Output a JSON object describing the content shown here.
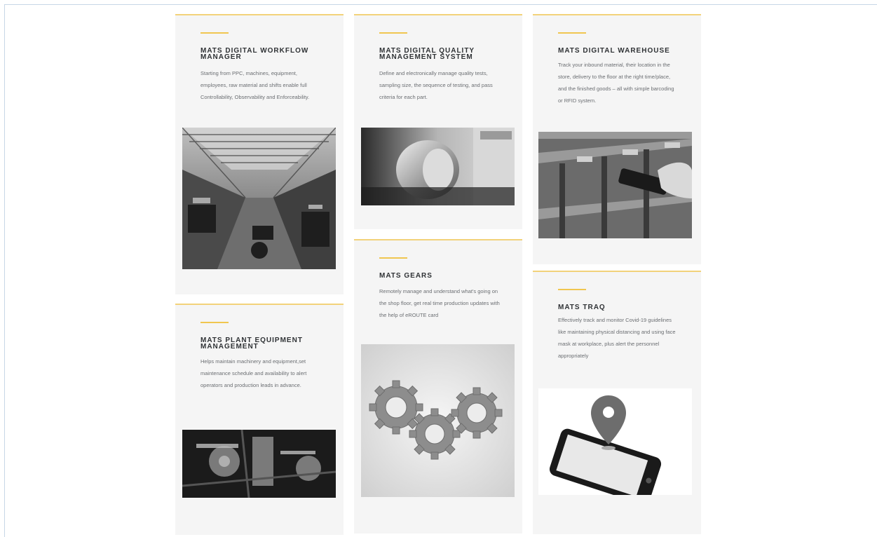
{
  "cards": [
    {
      "title": "MATS DIGITAL WORKFLOW MANAGER",
      "description": "Starting from PPC, machines, equipment, employees, raw material and shifts enable full Controllability, Observability and Enforceability.",
      "image": "factory-hall-photo"
    },
    {
      "title": "MATS DIGITAL QUALITY MANAGEMENT SYSTEM",
      "description": "Define and electronically manage quality tests, sampling size, the sequence of testing, and pass criteria for each part.",
      "image": "machined-ring-photo"
    },
    {
      "title": "MATS DIGITAL WAREHOUSE",
      "description": "Track your inbound material, their location in the store, delivery to the floor at the right time/place, and the finished goods – all with simple barcoding or RFID system.",
      "image": "barcode-scanner-shelves-photo"
    },
    {
      "title": "MATS PLANT EQUIPMENT MANAGEMENT",
      "description": "Helps maintain machinery and equipment,set maintenance schedule and availability to alert operators and production leads in advance.",
      "image": "machinery-closeup-photo"
    },
    {
      "title": "MATS GEARS",
      "description": "Remotely manage and understand what's going on the shop floor, get real time production updates with the help of eROUTE card",
      "image": "gears-illustration"
    },
    {
      "title": "MATS TRAQ",
      "description": "Effectively track and monitor Covid-19 guidelines like maintaining physical distancing and using face mask at workplace, plus alert the personnel appropriately",
      "image": "phone-location-pin-illustration"
    }
  ],
  "colors": {
    "accent": "#f0c650",
    "card_bg": "#f5f5f5",
    "title": "#2f3235",
    "text": "#6b6e72"
  }
}
